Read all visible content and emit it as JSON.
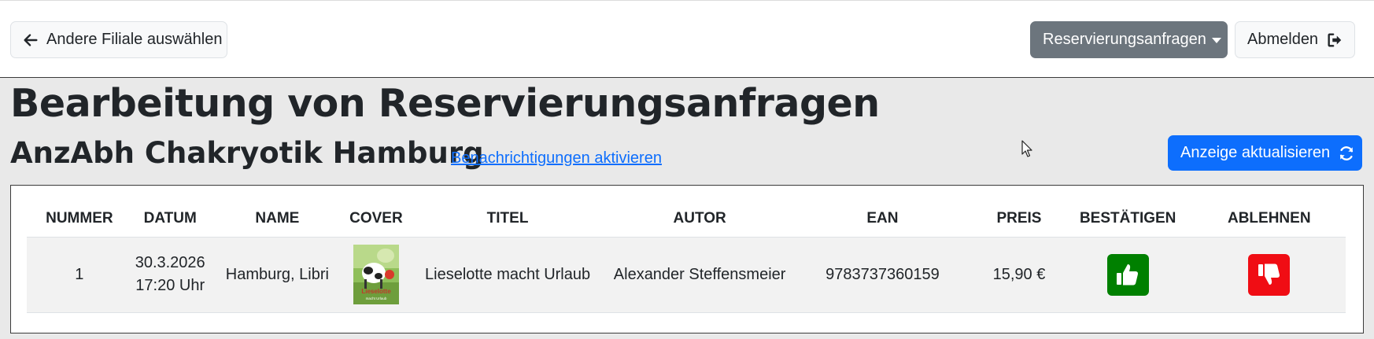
{
  "navbar": {
    "back_label": "Andere Filiale auswählen",
    "dropdown_label": "Reservierungsanfragen",
    "logout_label": "Abmelden"
  },
  "page": {
    "title": "Bearbeitung von Reservierungsanfragen",
    "branch": "AnzAbh Chakryotik Hamburg",
    "notify_link": "Benachrichtigungen aktivieren",
    "refresh_label": "Anzeige aktualisieren"
  },
  "table": {
    "headers": [
      "NUMMER",
      "DATUM",
      "NAME",
      "COVER",
      "TITEL",
      "AUTOR",
      "EAN",
      "PREIS",
      "BESTÄTIGEN",
      "ABLEHNEN"
    ],
    "rows": [
      {
        "nummer": "1",
        "datum": "30.3.2026",
        "uhrzeit": "17:20 Uhr",
        "name": "Hamburg, Libri",
        "cover_text": "Lieselotte",
        "cover_subtext": "macht Urlaub",
        "titel": "Lieselotte macht Urlaub",
        "autor": "Alexander Steffensmeier",
        "ean": "9783737360159",
        "preis": "15,90 €"
      }
    ]
  },
  "colors": {
    "primary": "#0d6efd",
    "secondary": "#6c757d",
    "confirm": "#008000",
    "reject": "#f00d14"
  },
  "icons": [
    "arrow-left-icon",
    "caret-down-icon",
    "sign-out-icon",
    "refresh-icon",
    "thumbs-up-icon",
    "thumbs-down-icon",
    "mouse-cursor-icon"
  ]
}
